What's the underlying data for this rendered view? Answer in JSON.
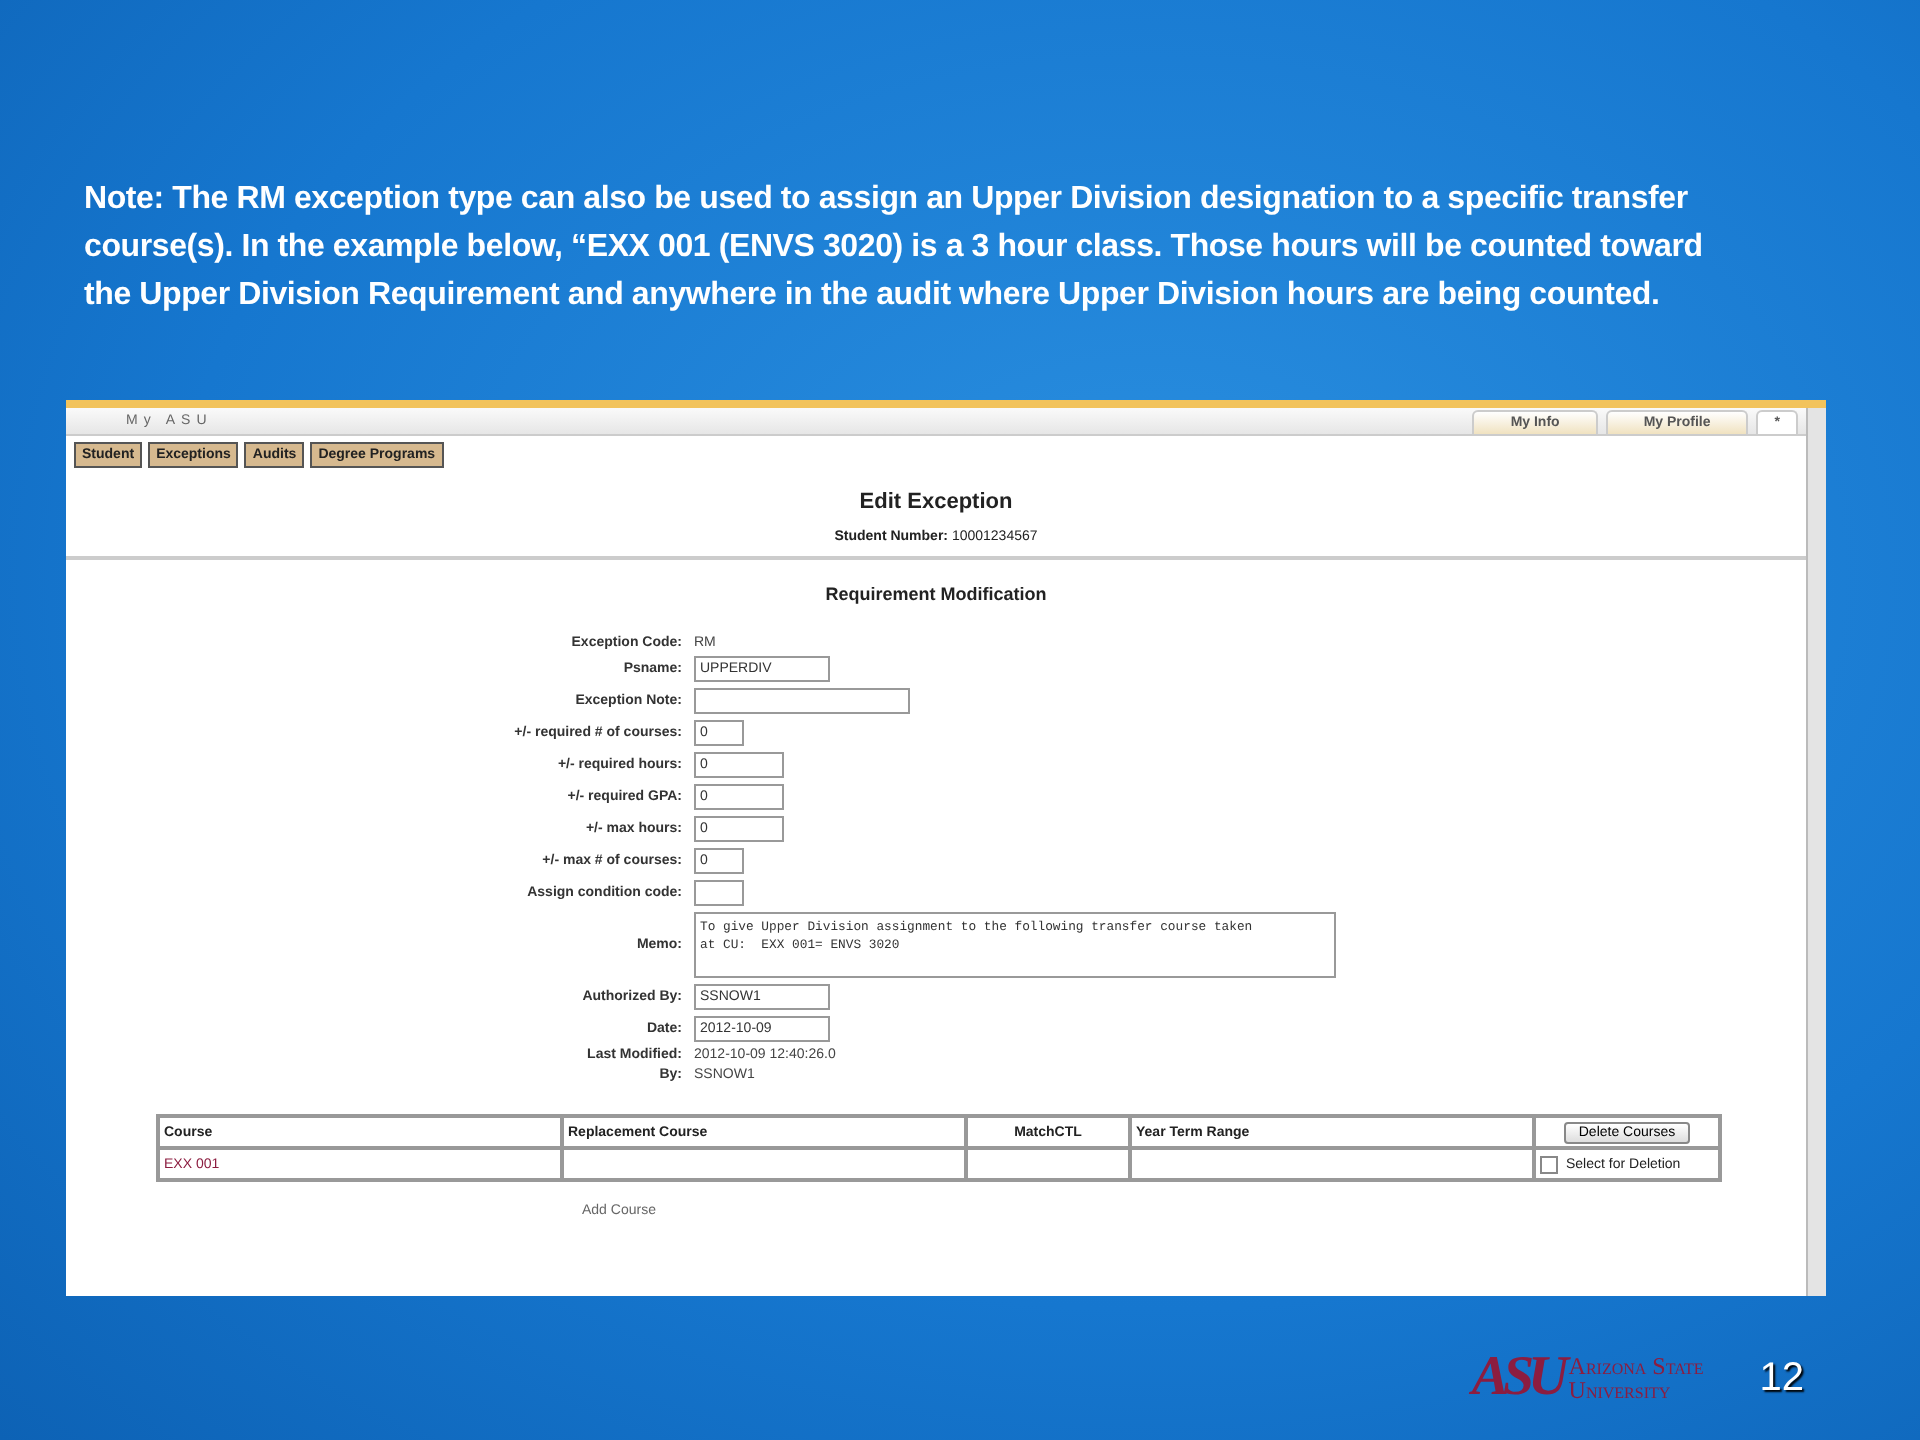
{
  "note": "Note:  The RM exception type can also be used to assign an Upper Division designation to a specific transfer course(s). In the example below, “EXX 001 (ENVS 3020) is a 3 hour class. Those hours will be counted toward the Upper Division Requirement and anywhere in the audit where Upper Division hours are being counted.",
  "app": {
    "brand": "My ASU",
    "tabs": [
      {
        "label": "My Info",
        "selected": false
      },
      {
        "label": "My Profile",
        "selected": false
      },
      {
        "label": "*",
        "selected": true
      }
    ],
    "nav_buttons": [
      "Student",
      "Exceptions",
      "Audits",
      "Degree Programs"
    ],
    "title": "Edit Exception",
    "student_number": {
      "label": "Student Number:",
      "value": "10001234567"
    },
    "section_title": "Requirement Modification",
    "fields": [
      {
        "label": "Exception Code:",
        "kind": "text",
        "value": "RM"
      },
      {
        "label": "Psname:",
        "kind": "input-wide",
        "value": "UPPERDIV"
      },
      {
        "label": "Exception Note:",
        "kind": "input-long"
      },
      {
        "label": "+/- required # of courses:",
        "kind": "input-short",
        "value": "0"
      },
      {
        "label": "+/- required hours:",
        "kind": "input",
        "value": "0"
      },
      {
        "label": "+/- required GPA:",
        "kind": "input",
        "value": "0"
      },
      {
        "label": "+/- max hours:",
        "kind": "input",
        "value": "0"
      },
      {
        "label": "+/- max # of courses:",
        "kind": "input-short",
        "value": "0"
      },
      {
        "label": "Assign condition code:",
        "kind": "input-short"
      },
      {
        "label": "Memo:",
        "kind": "memo",
        "value": "To give Upper Division assignment to the following transfer course taken\nat CU:  EXX 001= ENVS 3020"
      },
      {
        "label": "Authorized By:",
        "kind": "input-wide",
        "value": "SSNOW1"
      },
      {
        "label": "Date:",
        "kind": "input-wide",
        "value": "2012-10-09"
      },
      {
        "label": "Last Modified:",
        "kind": "text",
        "value": "2012-10-09 12:40:26.0"
      },
      {
        "label": "By:",
        "kind": "text",
        "value": "SSNOW1"
      }
    ],
    "table": {
      "columns": [
        "Course",
        "Replacement Course",
        "MatchCTL",
        "Year Term Range"
      ],
      "delete_button": "Delete Courses",
      "rows": [
        {
          "course": "EXX 001",
          "select_label": "Select for Deletion",
          "checked": false
        }
      ]
    },
    "add_course": "Add Course"
  },
  "logo": {
    "mark": "ASU",
    "line_1": "Arizona State",
    "line_2": "University"
  },
  "page_number": "12"
}
